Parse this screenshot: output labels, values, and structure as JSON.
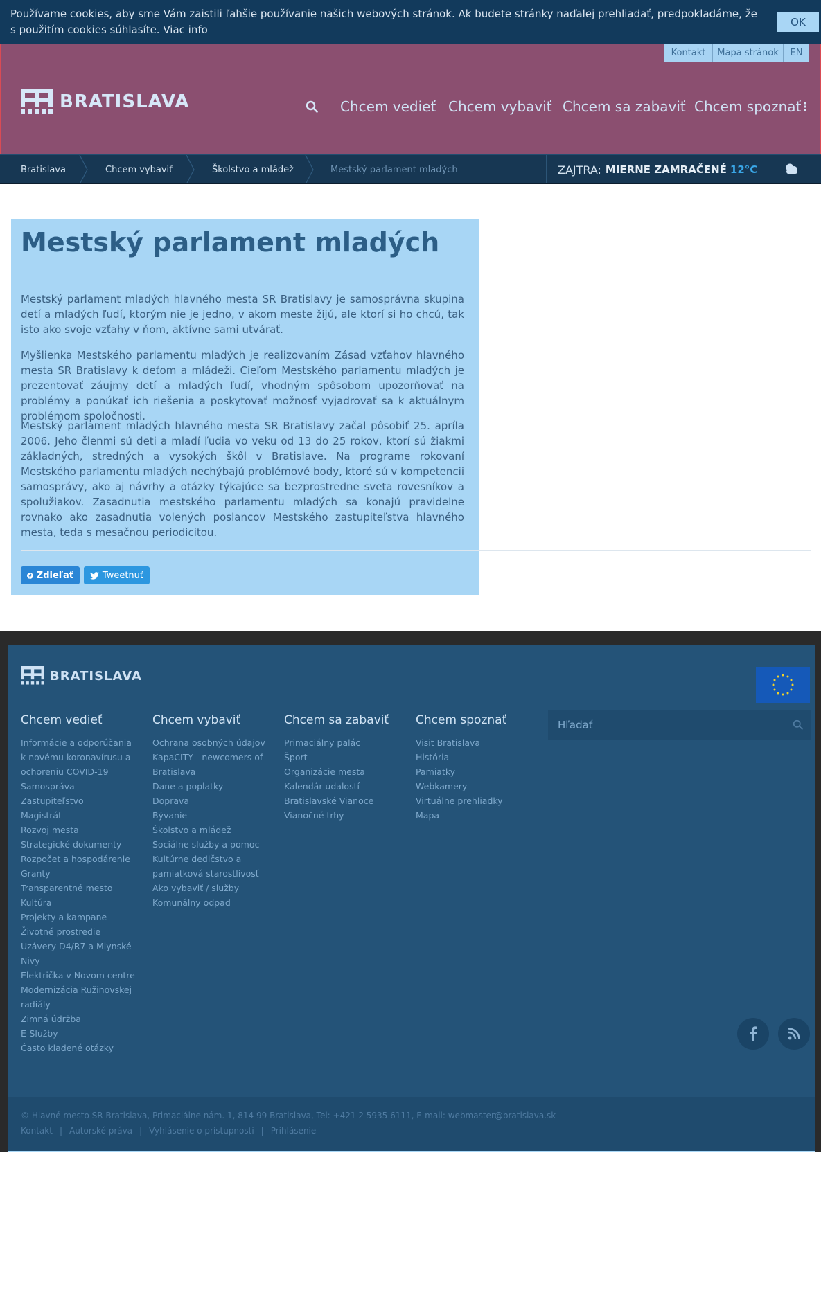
{
  "cookie": {
    "text": "Používame cookies, aby sme Vám zaistili ľahšie používanie našich webových stránok. Ak budete stránky naďalej prehliadať, predpokladáme, že s použitím cookies súhlasíte.",
    "link": "Viac info",
    "ok": "OK"
  },
  "utility": {
    "kontakt": "Kontakt",
    "mapa": "Mapa stránok",
    "lang": "EN"
  },
  "header": {
    "logo": "BRATISLAVA",
    "nav": [
      "Chcem vedieť",
      "Chcem vybaviť",
      "Chcem sa zabaviť",
      "Chcem spoznať"
    ]
  },
  "breadcrumb": [
    "Bratislava",
    "Chcem vybaviť",
    "Školstvo a mládež",
    "Mestský parlament mladých"
  ],
  "weather": {
    "label": "ZAJTRA:",
    "condition": "MIERNE ZAMRAČENÉ",
    "temp": "12°C"
  },
  "article": {
    "title": "Mestský parlament mladých",
    "paragraphs": [
      "Mestský parlament mladých hlavného mesta SR Bratislavy je samosprávna skupina detí a mladých ľudí, ktorým nie je jedno, v akom meste žijú, ale ktorí si ho chcú, tak isto ako svoje vzťahy v ňom, aktívne sami utvárať.",
      "Myšlienka Mestského parlamentu mladých je realizovaním Zásad vzťahov hlavného mesta SR Bratislavy k deťom a mládeži. Cieľom Mestského parlamentu mladých je prezentovať záujmy detí a mladých ľudí, vhodným spôsobom upozorňovať na problémy a ponúkať ich riešenia a poskytovať možnosť vyjadrovať sa k aktuálnym problémom spoločnosti.",
      "Mestský parlament mladých hlavného mesta SR Bratislavy začal pôsobiť 25. apríla 2006. Jeho členmi sú deti a mladí ľudia vo veku od 13 do 25 rokov, ktorí sú žiakmi základných, stredných a vysokých škôl v Bratislave. Na programe rokovaní Mestského parlamentu mladých nechýbajú problémové body, ktoré sú v kompetencii samosprávy, ako aj návrhy a otázky týkajúce sa bezprostredne sveta rovesníkov a spolužiakov. Zasadnutia mestského parlamentu mladých sa konajú pravidelne rovnako ako zasadnutia volených poslancov Mestského zastupiteľstva hlavného mesta, teda s mesačnou periodicitou."
    ],
    "share_fb": "Zdieľať",
    "share_tw": "Tweetnuť"
  },
  "footer": {
    "logo": "BRATISLAVA",
    "columns": [
      {
        "title": "Chcem vedieť",
        "items": [
          "Informácie a odporúčania k novému koronavírusu a ochoreniu COVID-19",
          "Samospráva",
          "Zastupiteľstvo",
          "Magistrát",
          "Rozvoj mesta",
          "Strategické dokumenty",
          "Rozpočet a hospodárenie",
          "Granty",
          "Transparentné mesto",
          "Kultúra",
          "Projekty a kampane",
          "Životné prostredie",
          "Uzávery D4/R7 a Mlynské Nivy",
          "Električka v Novom centre",
          "Modernizácia Ružinovskej radiály",
          "Zimná údržba",
          "E-Služby",
          "Často kladené otázky"
        ]
      },
      {
        "title": "Chcem vybaviť",
        "items": [
          "Ochrana osobných údajov",
          "KapaCITY - newcomers of Bratislava",
          "Dane a poplatky",
          "Doprava",
          "Bývanie",
          "Školstvo a mládež",
          "Sociálne služby a pomoc",
          "Kultúrne dedičstvo a pamiatková starostlivosť",
          "Ako vybaviť / služby",
          "Komunálny odpad"
        ]
      },
      {
        "title": "Chcem sa zabaviť",
        "items": [
          "Primaciálny palác",
          "Šport",
          "Organizácie mesta",
          "Kalendár udalostí",
          "Bratislavské Vianoce",
          "Vianočné trhy"
        ]
      },
      {
        "title": "Chcem spoznať",
        "items": [
          "Visit Bratislava",
          "História",
          "Pamiatky",
          "Webkamery",
          "Virtuálne prehliadky",
          "Mapa"
        ]
      }
    ],
    "search_placeholder": "Hľadať",
    "copyright": "© Hlavné mesto SR Bratislava, Primaciálne nám. 1, 814 99 Bratislava, Tel: +421 2 5935 6111, E-mail: webmaster@bratislava.sk",
    "legal": [
      "Kontakt",
      "Autorské práva",
      "Vyhlásenie o prístupnosti",
      "Prihlásenie"
    ]
  },
  "colors": {
    "header": "#8b4f70",
    "article_bg": "#a8d6f5",
    "footer": "#245378",
    "accent": "#2a86d6"
  },
  "icons": [
    "search-icon",
    "more-vertical-icon",
    "cloud-icon",
    "facebook-icon",
    "twitter-icon",
    "rss-icon",
    "eu-flag-icon"
  ]
}
